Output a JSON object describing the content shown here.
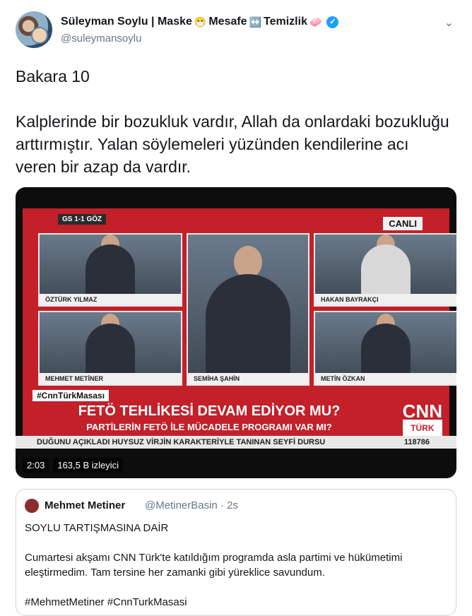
{
  "tweet": {
    "author_name": "Süleyman Soylu | Maske",
    "name_emoji1": "😷",
    "name_part2": "Mesafe",
    "name_emoji2": "↔️",
    "name_part3": "Temizlik",
    "name_emoji3": "🧼",
    "handle": "@suleymansoylu",
    "text_line1": "Bakara 10",
    "text_body": "Kalplerinde bir bozukluk vardır, Allah da onlardaki bozukluğu arttırmıştır. Yalan söylemeleri yüzünden kendilerine acı veren bir azap da vardır."
  },
  "video": {
    "score": "GS 1-1 GÖZ",
    "canli": "CANLI",
    "panels": [
      {
        "caption": "ÖZTÜRK YILMAZ"
      },
      {
        "caption": "SEMİHA ŞAHİN"
      },
      {
        "caption": "HAKAN BAYRAKÇI"
      },
      {
        "caption": "MEHMET METİNER"
      },
      {
        "caption": "METİN ÖZKAN"
      }
    ],
    "hashtag": "#CnnTürkMasası",
    "headline": "FETÖ TEHLİKESİ DEVAM EDİYOR MU?",
    "subheadline": "PARTİLERİN FETÖ İLE MÜCADELE PROGRAMI VAR MI?",
    "logo": "CNN",
    "logo_sub": "TÜRK",
    "ticker": "DUĞUNU AÇIKLADI   HUYSUZ VİRJİN KARAKTERİYLE TANINAN SEYFİ DURSU",
    "ticker_num": "118786",
    "duration": "2:03",
    "views": "163,5 B izleyici"
  },
  "quote": {
    "name": "Mehmet Metiner",
    "handle": "@MetinerBasin · 2s",
    "title": "SOYLU TARTIŞMASINA DAİR",
    "body": "Cumartesi akşamı CNN Türk'te katıldığım programda asla partimi ve hükümetimi eleştirmedim. Tam tersine her zamanki gibi yüreklice savundum.",
    "hashtags": "#MehmetMetiner #CnnTurkMasasi"
  },
  "colors": {
    "accent": "#1da1f2",
    "cnn_red": "#c3202a"
  }
}
